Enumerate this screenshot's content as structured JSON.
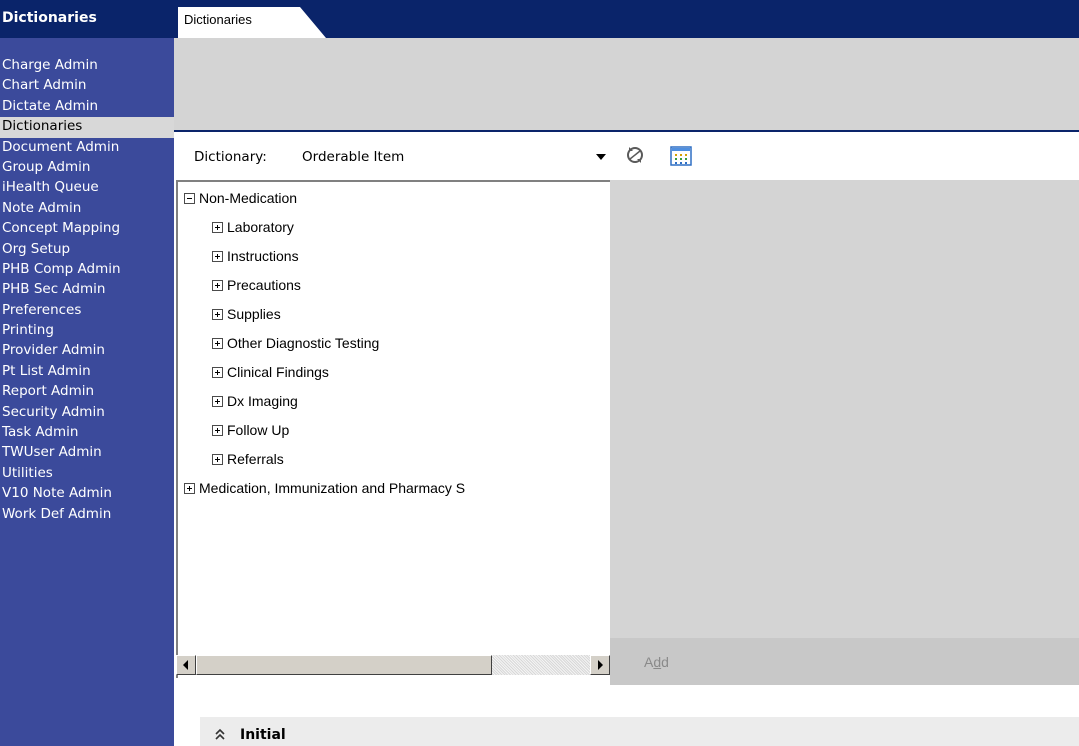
{
  "sidebar": {
    "title": "Dictionaries",
    "items": [
      {
        "label": "Charge Admin",
        "active": false
      },
      {
        "label": "Chart Admin",
        "active": false
      },
      {
        "label": "Dictate Admin",
        "active": false
      },
      {
        "label": "Dictionaries",
        "active": true
      },
      {
        "label": "Document Admin",
        "active": false
      },
      {
        "label": "Group Admin",
        "active": false
      },
      {
        "label": "iHealth Queue",
        "active": false
      },
      {
        "label": "Note Admin",
        "active": false
      },
      {
        "label": "Concept Mapping",
        "active": false
      },
      {
        "label": "Org Setup",
        "active": false
      },
      {
        "label": "PHB Comp Admin",
        "active": false
      },
      {
        "label": "PHB Sec Admin",
        "active": false
      },
      {
        "label": "Preferences",
        "active": false
      },
      {
        "label": "Printing",
        "active": false
      },
      {
        "label": "Provider Admin",
        "active": false
      },
      {
        "label": "Pt List Admin",
        "active": false
      },
      {
        "label": "Report Admin",
        "active": false
      },
      {
        "label": "Security Admin",
        "active": false
      },
      {
        "label": "Task Admin",
        "active": false
      },
      {
        "label": "TWUser Admin",
        "active": false
      },
      {
        "label": "Utilities",
        "active": false
      },
      {
        "label": "V10 Note Admin",
        "active": false
      },
      {
        "label": "Work Def Admin",
        "active": false
      }
    ]
  },
  "tabs": {
    "active_label": "Dictionaries"
  },
  "dictionary": {
    "label": "Dictionary:",
    "selected_value": "Orderable Item"
  },
  "tree": [
    {
      "label": "Non-Medication",
      "expanded": true,
      "level": 0
    },
    {
      "label": "Laboratory",
      "expanded": false,
      "level": 1
    },
    {
      "label": "Instructions",
      "expanded": false,
      "level": 1
    },
    {
      "label": "Precautions",
      "expanded": false,
      "level": 1
    },
    {
      "label": "Supplies",
      "expanded": false,
      "level": 1
    },
    {
      "label": "Other Diagnostic Testing",
      "expanded": false,
      "level": 1
    },
    {
      "label": "Clinical Findings",
      "expanded": false,
      "level": 1
    },
    {
      "label": "Dx Imaging",
      "expanded": false,
      "level": 1
    },
    {
      "label": "Follow Up",
      "expanded": false,
      "level": 1
    },
    {
      "label": "Referrals",
      "expanded": false,
      "level": 1
    },
    {
      "label": "Medication, Immunization and Pharmacy S",
      "expanded": false,
      "level": 0
    }
  ],
  "detail": {
    "add_label_before": "A",
    "add_label_mnemonic": "d",
    "add_label_after": "d"
  },
  "bottom": {
    "section_title": "Initial"
  },
  "icons": {
    "dropdown": "dropdown-arrow-icon",
    "refresh": "refresh-icon",
    "grid": "column-grid-icon",
    "collapse": "chevron-up-double-icon"
  },
  "colors": {
    "nav_background": "#3b4a9b",
    "title_bar": "#0a246a",
    "active_item": "#d8d8d8",
    "panel_grey": "#d4d4d4"
  }
}
